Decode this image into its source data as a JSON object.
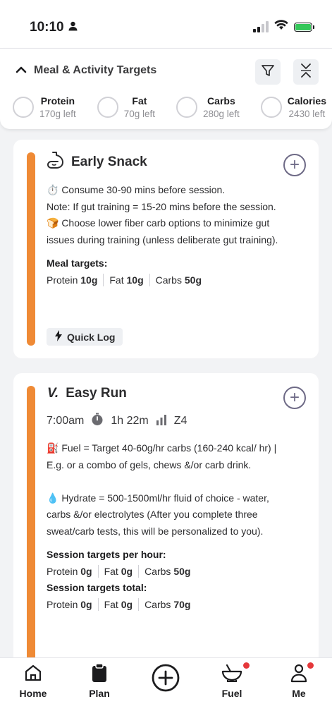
{
  "status_bar": {
    "time": "10:10"
  },
  "targets_panel": {
    "title": "Meal & Activity Targets",
    "macros": [
      {
        "name": "Protein",
        "left": "170g left"
      },
      {
        "name": "Fat",
        "left": "70g left"
      },
      {
        "name": "Carbs",
        "left": "280g left"
      },
      {
        "name": "Calories",
        "left": "2430 left"
      }
    ]
  },
  "snack_card": {
    "title": "Early Snack",
    "line1": "⏱️ Consume 30-90 mins before session.",
    "line2": "Note: If gut training = 15-20 mins before the session.",
    "line3": "🍞 Choose lower fiber carb options to minimize gut issues during training (unless deliberate gut training).",
    "targets_label": "Meal targets:",
    "targets": {
      "protein_label": "Protein",
      "protein": "10g",
      "fat_label": "Fat",
      "fat": "10g",
      "carbs_label": "Carbs",
      "carbs": "50g"
    },
    "quick_log": "Quick Log"
  },
  "run_card": {
    "title": "Easy Run",
    "time": "7:00am",
    "duration": "1h 22m",
    "zone": "Z4",
    "fuel": "⛽ Fuel = Target 40-60g/hr carbs (160-240 kcal/ hr)  | E.g. or a combo of gels, chews &/or carb drink.",
    "hydrate": "💧 Hydrate = 500-1500ml/hr fluid of choice - water, carbs &/or electrolytes (After you complete three sweat/carb tests, this will be personalized to you).",
    "per_hour_label": "Session targets per hour:",
    "per_hour": {
      "protein_label": "Protein",
      "protein": "0g",
      "fat_label": "Fat",
      "fat": "0g",
      "carbs_label": "Carbs",
      "carbs": "50g"
    },
    "total_label": "Session targets total:",
    "total": {
      "protein_label": "Protein",
      "protein": "0g",
      "fat_label": "Fat",
      "fat": "0g",
      "carbs_label": "Carbs",
      "carbs": "70g"
    }
  },
  "tabbar": {
    "home": "Home",
    "plan": "Plan",
    "fuel": "Fuel",
    "me": "Me"
  },
  "colors": {
    "accent_bar": "#ef8a35",
    "notification_dot": "#e5383b"
  }
}
